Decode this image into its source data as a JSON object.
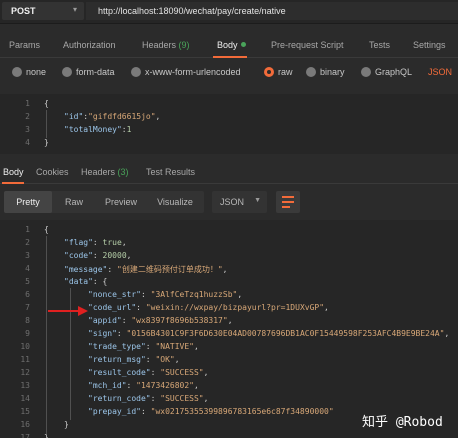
{
  "request": {
    "method": "POST",
    "url": "http://localhost:18090/wechat/pay/create/native"
  },
  "request_tabs": [
    {
      "label": "Params"
    },
    {
      "label": "Authorization"
    },
    {
      "label": "Headers",
      "count": "(9)"
    },
    {
      "label": "Body",
      "active": true
    },
    {
      "label": "Pre-request Script"
    },
    {
      "label": "Tests"
    },
    {
      "label": "Settings"
    }
  ],
  "body_types": [
    {
      "label": "none"
    },
    {
      "label": "form-data"
    },
    {
      "label": "x-www-form-urlencoded"
    },
    {
      "label": "raw",
      "selected": true
    },
    {
      "label": "binary"
    },
    {
      "label": "GraphQL"
    }
  ],
  "body_format": "JSON",
  "request_body": {
    "line_numbers": [
      "1",
      "2",
      "3",
      "4"
    ],
    "lines": [
      {
        "open": "{"
      },
      {
        "key": "\"id\"",
        "colon": ":",
        "value": "\"gifdfd6615jo\"",
        "comma": ","
      },
      {
        "key": "\"totalMoney\"",
        "colon": ":",
        "value": "1"
      },
      {
        "open": "}"
      }
    ]
  },
  "response_tabs": [
    {
      "label": "Body",
      "active": true
    },
    {
      "label": "Cookies"
    },
    {
      "label": "Headers",
      "count": "(3)"
    },
    {
      "label": "Test Results"
    }
  ],
  "view_modes": [
    {
      "label": "Pretty",
      "active": true
    },
    {
      "label": "Raw"
    },
    {
      "label": "Preview"
    },
    {
      "label": "Visualize"
    }
  ],
  "response_format": "JSON",
  "response_body": {
    "line_numbers": [
      "1",
      "2",
      "3",
      "4",
      "5",
      "6",
      "7",
      "8",
      "9",
      "10",
      "11",
      "12",
      "13",
      "14",
      "15",
      "16",
      "17"
    ],
    "lines": [
      {
        "open": "{"
      },
      {
        "key": "\"flag\"",
        "value": "true",
        "type": "n"
      },
      {
        "key": "\"code\"",
        "value": "20000",
        "type": "n"
      },
      {
        "key": "\"message\"",
        "value": "\"创建二维码预付订单成功！\"",
        "type": "s"
      },
      {
        "key": "\"data\"",
        "value": "{",
        "type": "w"
      },
      {
        "key": "\"nonce_str\"",
        "value": "\"3AlfCeTzq1huzzSb\"",
        "type": "s"
      },
      {
        "key": "\"code_url\"",
        "value": "\"weixin://wxpay/bizpayurl?pr=1DUXvGP\"",
        "type": "s"
      },
      {
        "key": "\"appid\"",
        "value": "\"wx8397f8696b538317\"",
        "type": "s"
      },
      {
        "key": "\"sign\"",
        "value": "\"0156B4301C9F3F6D630E04AD00787696DB1AC0F15449598F253AFC4B9E9BE24A\"",
        "type": "s"
      },
      {
        "key": "\"trade_type\"",
        "value": "\"NATIVE\"",
        "type": "s"
      },
      {
        "key": "\"return_msg\"",
        "value": "\"OK\"",
        "type": "s"
      },
      {
        "key": "\"result_code\"",
        "value": "\"SUCCESS\"",
        "type": "s"
      },
      {
        "key": "\"mch_id\"",
        "value": "\"1473426802\"",
        "type": "s"
      },
      {
        "key": "\"return_code\"",
        "value": "\"SUCCESS\"",
        "type": "s"
      },
      {
        "key": "\"prepay_id\"",
        "value": "\"wx02175355399896783165e6c87f34890000\"",
        "type": "s"
      },
      {
        "open": "}"
      },
      {
        "open": "}"
      }
    ]
  },
  "watermark": "知乎 @Robod",
  "colors": {
    "accent": "#f26b3a",
    "count_green": "#49a35a",
    "annotation_red": "#e02020"
  },
  "icons": {
    "method_dropdown": "chevron-down-icon",
    "format_dropdown": "chevron-down-icon",
    "wrap": "wrap-lines-icon",
    "annotation": "red-arrow-icon"
  }
}
